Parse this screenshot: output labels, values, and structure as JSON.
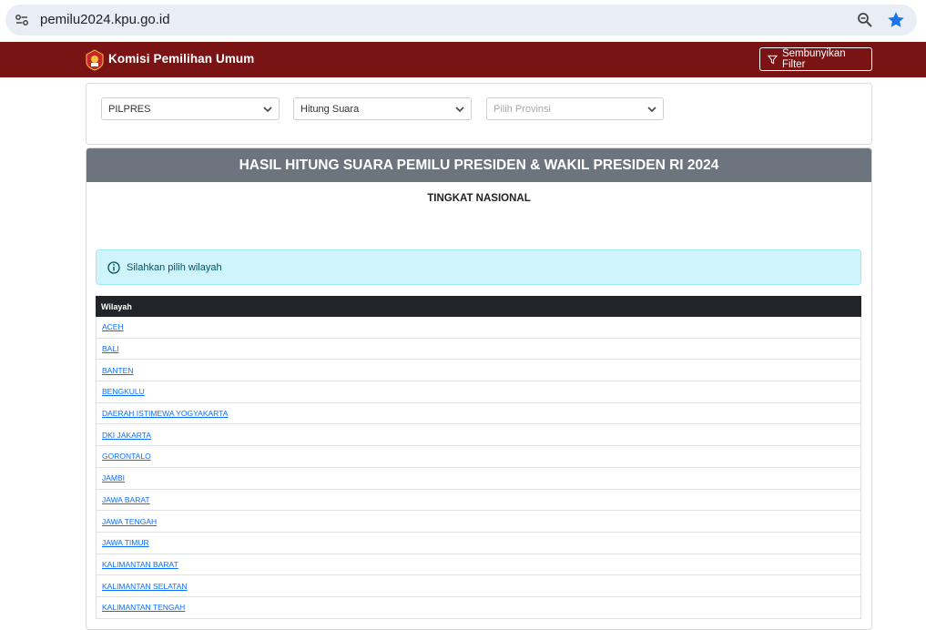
{
  "browser": {
    "url": "pemilu2024.kpu.go.id"
  },
  "header": {
    "brand": "Komisi Pemilihan Umum",
    "filter_button": "Sembunyikan Filter"
  },
  "filters": {
    "election": "PILPRES",
    "mode": "Hitung Suara",
    "province_placeholder": "Pilih Provinsi"
  },
  "panel": {
    "title": "HASIL HITUNG SUARA PEMILU PRESIDEN & WAKIL PRESIDEN RI 2024",
    "level": "TINGKAT NASIONAL",
    "alert": "Silahkan pilih wilayah",
    "table_header": "Wilayah",
    "regions": [
      "ACEH",
      "BALI",
      "BANTEN",
      "BENGKULU",
      "DAERAH ISTIMEWA YOGYAKARTA",
      "DKI JAKARTA",
      "GORONTALO",
      "JAMBI",
      "JAWA BARAT",
      "JAWA TENGAH",
      "JAWA TIMUR",
      "KALIMANTAN BARAT",
      "KALIMANTAN SELATAN",
      "KALIMANTAN TENGAH"
    ]
  },
  "colors": {
    "nav_bg": "#7a1313",
    "panel_head_bg": "#6c757d",
    "alert_bg": "#cff4fc",
    "table_head_bg": "#212529",
    "link": "#0d6efd"
  }
}
